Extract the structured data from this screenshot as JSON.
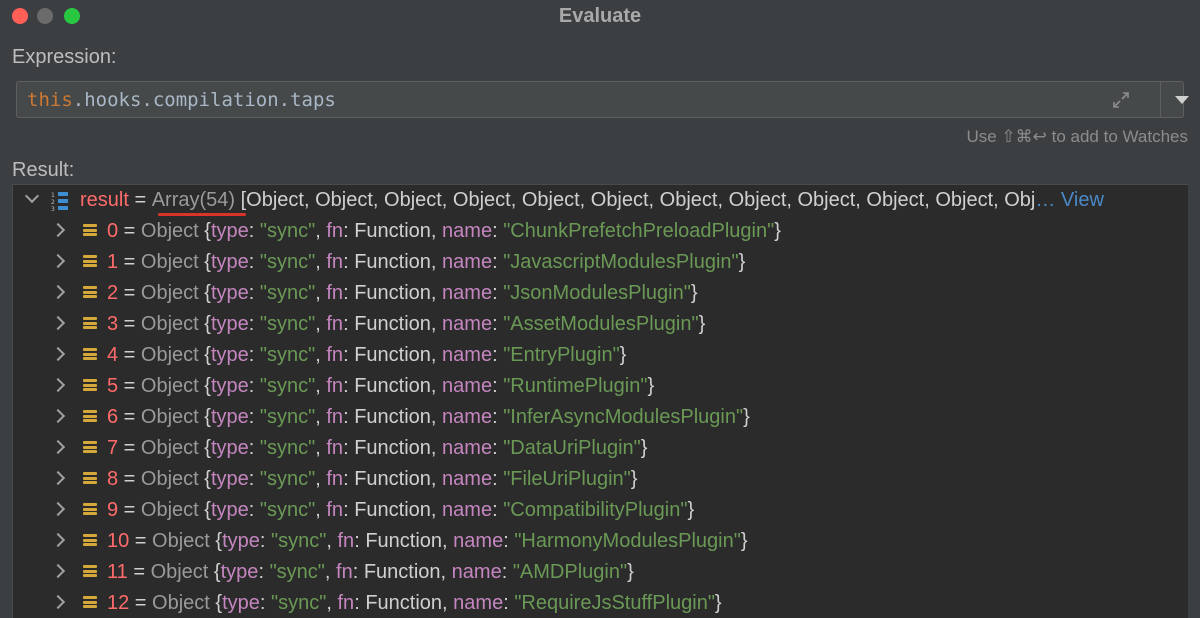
{
  "window": {
    "title": "Evaluate"
  },
  "expression": {
    "label": "Expression:",
    "keyword": "this",
    "rest": ".hooks.compilation.taps",
    "hint": "Use ⇧⌘↩ to add to Watches"
  },
  "result": {
    "label": "Result:",
    "root": {
      "name": "result",
      "eq": " = ",
      "type": "Array(54)",
      "summary": " [Object, Object, Object, Object, Object, Object, Object, Object, Object, Object, Object, Obj",
      "ellipsis": "…",
      "view": " View"
    },
    "items": [
      {
        "index": "0",
        "type": "Object",
        "value_type": "\"sync\"",
        "fn": "Function",
        "name": "\"ChunkPrefetchPreloadPlugin\""
      },
      {
        "index": "1",
        "type": "Object",
        "value_type": "\"sync\"",
        "fn": "Function",
        "name": "\"JavascriptModulesPlugin\""
      },
      {
        "index": "2",
        "type": "Object",
        "value_type": "\"sync\"",
        "fn": "Function",
        "name": "\"JsonModulesPlugin\""
      },
      {
        "index": "3",
        "type": "Object",
        "value_type": "\"sync\"",
        "fn": "Function",
        "name": "\"AssetModulesPlugin\""
      },
      {
        "index": "4",
        "type": "Object",
        "value_type": "\"sync\"",
        "fn": "Function",
        "name": "\"EntryPlugin\""
      },
      {
        "index": "5",
        "type": "Object",
        "value_type": "\"sync\"",
        "fn": "Function",
        "name": "\"RuntimePlugin\""
      },
      {
        "index": "6",
        "type": "Object",
        "value_type": "\"sync\"",
        "fn": "Function",
        "name": "\"InferAsyncModulesPlugin\""
      },
      {
        "index": "7",
        "type": "Object",
        "value_type": "\"sync\"",
        "fn": "Function",
        "name": "\"DataUriPlugin\""
      },
      {
        "index": "8",
        "type": "Object",
        "value_type": "\"sync\"",
        "fn": "Function",
        "name": "\"FileUriPlugin\""
      },
      {
        "index": "9",
        "type": "Object",
        "value_type": "\"sync\"",
        "fn": "Function",
        "name": "\"CompatibilityPlugin\""
      },
      {
        "index": "10",
        "type": "Object",
        "value_type": "\"sync\"",
        "fn": "Function",
        "name": "\"HarmonyModulesPlugin\""
      },
      {
        "index": "11",
        "type": "Object",
        "value_type": "\"sync\"",
        "fn": "Function",
        "name": "\"AMDPlugin\""
      },
      {
        "index": "12",
        "type": "Object",
        "value_type": "\"sync\"",
        "fn": "Function",
        "name": "\"RequireJsStuffPlugin\""
      }
    ]
  },
  "icons": {
    "expand": "expand-icon",
    "dropdown": "chevron-down-icon",
    "array": "array-icon",
    "object": "object-icon"
  },
  "colors": {
    "index": "#ff6b6b",
    "key": "#c586c0",
    "string": "#6a9955",
    "keyword": "#cc7832",
    "link": "#4a88c7",
    "underline": "#d9342b"
  }
}
